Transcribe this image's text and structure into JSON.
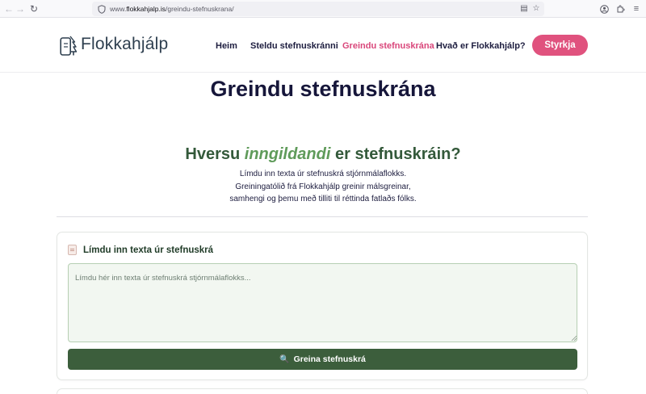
{
  "browser": {
    "url_prefix": "www.",
    "url_host": "flokkahjalp.is",
    "url_path": "/greindu-stefnuskrana/",
    "back_icon": "arrow-left",
    "forward_icon": "arrow-right",
    "reload_icon": "reload"
  },
  "header": {
    "logo_text": "Flokkahjálp",
    "nav": [
      {
        "label": "Heim"
      },
      {
        "label": "Steldu stefnuskránni"
      },
      {
        "label": "Greindu stefnuskrána",
        "active": true
      },
      {
        "label": "Hvað er Flokkahjálp?"
      }
    ],
    "donate_label": "Styrkja"
  },
  "main": {
    "page_title": "Greindu stefnuskrána",
    "hero": {
      "heading_pre": "Hversu",
      "heading_em": "inngildandi",
      "heading_post": "er stefnuskráin?",
      "desc_line1": "Límdu inn texta úr stefnuskrá stjórnmálaflokks.",
      "desc_line2": "Greiningatólið frá Flokkahjálp greinir málsgreinar,",
      "desc_line3": "samhengi og þemu með tilliti til réttinda fatlaðs fólks."
    },
    "card": {
      "title": "Límdu inn texta úr stefnuskrá",
      "textarea_placeholder": "Límdu hér inn texta úr stefnuskrá stjórnmálaflokks...",
      "textarea_value": "",
      "button_label": "Greina stefnuskrá"
    }
  },
  "colors": {
    "accent_pink": "#e0527e",
    "nav_active": "#d9467a",
    "green_dark": "#3c5e3c",
    "green_heading": "#33593a",
    "green_emphasis": "#5f9b5a",
    "title_navy": "#16163a"
  }
}
